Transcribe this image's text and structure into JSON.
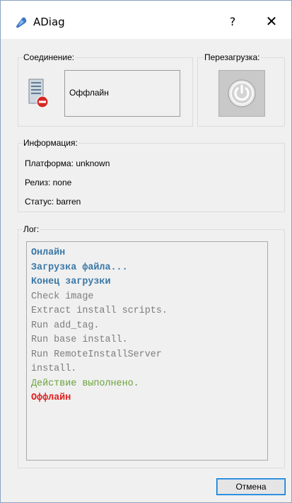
{
  "window": {
    "title": "ADiag",
    "help_label": "?",
    "close_label": "✕"
  },
  "connection": {
    "legend": "Соединение:",
    "status": "Оффлайн",
    "icon": "server-offline-icon"
  },
  "reboot": {
    "legend": "Перезагрузка:",
    "icon": "power-icon"
  },
  "info": {
    "legend": "Информация:",
    "platform": "Платформа: unknown",
    "release": "Релиз: none",
    "status": "Статус: barren"
  },
  "log": {
    "legend": "Лог:",
    "lines": [
      {
        "text": "Онлайн",
        "color": "#3a78a6",
        "bold": true
      },
      {
        "text": "Загрузка файла...",
        "color": "#3a78a6",
        "bold": true
      },
      {
        "text": "Конец загрузки",
        "color": "#3a78a6",
        "bold": true
      },
      {
        "text": "Check image",
        "color": "#7d7d7d",
        "bold": false
      },
      {
        "text": "Extract install scripts.",
        "color": "#7d7d7d",
        "bold": false
      },
      {
        "text": "Run add_tag.",
        "color": "#7d7d7d",
        "bold": false
      },
      {
        "text": "Run base install.",
        "color": "#7d7d7d",
        "bold": false
      },
      {
        "text": "Run RemoteInstallServer",
        "color": "#7d7d7d",
        "bold": false
      },
      {
        "text": "install.",
        "color": "#7d7d7d",
        "bold": false
      },
      {
        "text": "Действие выполнено.",
        "color": "#6aa33a",
        "bold": false
      },
      {
        "text": "Оффлайн",
        "color": "#e02020",
        "bold": true
      }
    ]
  },
  "footer": {
    "cancel_label": "Отмена"
  }
}
